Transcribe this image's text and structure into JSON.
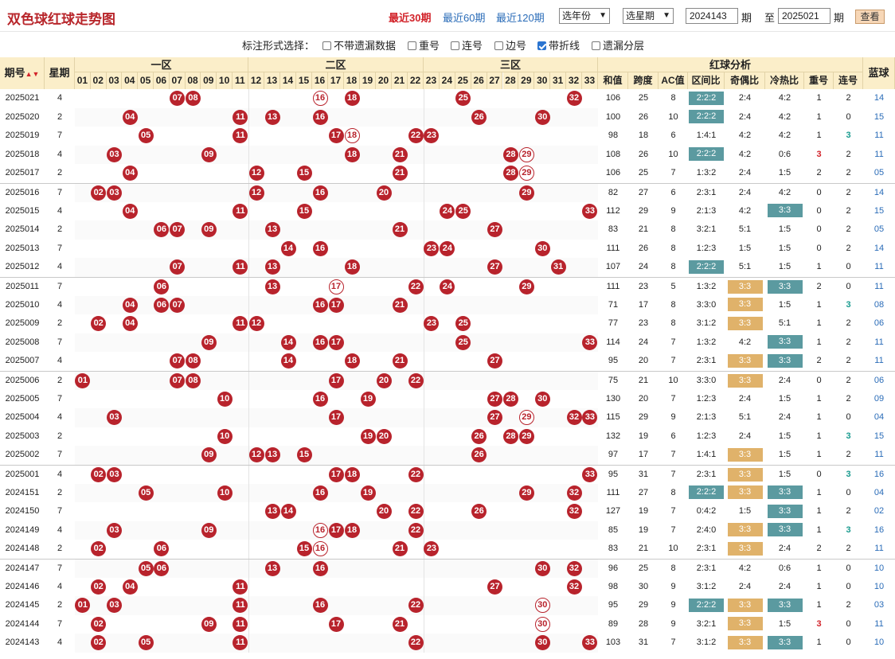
{
  "header": {
    "title": "双色球红球走势图",
    "periods": [
      {
        "label": "最近30期",
        "active": true
      },
      {
        "label": "最近60期",
        "active": false
      },
      {
        "label": "最近120期",
        "active": false
      }
    ],
    "year_select": "选年份",
    "week_select": "选星期",
    "from_issue": "2024143",
    "issue_unit": "期",
    "to_label": "至",
    "to_issue": "2025021",
    "query_button": "查看"
  },
  "options": {
    "label": "标注形式选择：",
    "items": [
      {
        "label": "不带遗漏数据",
        "checked": false
      },
      {
        "label": "重号",
        "checked": false
      },
      {
        "label": "连号",
        "checked": false
      },
      {
        "label": "边号",
        "checked": false
      },
      {
        "label": "带折线",
        "checked": true
      },
      {
        "label": "遗漏分层",
        "checked": false
      }
    ]
  },
  "table_header": {
    "issue": "期号",
    "weekday": "星期",
    "zone1": "一区",
    "zone2": "二区",
    "zone3": "三区",
    "analysis": "红球分析",
    "blue": "蓝球",
    "numbers": [
      "01",
      "02",
      "03",
      "04",
      "05",
      "06",
      "07",
      "08",
      "09",
      "10",
      "11",
      "12",
      "13",
      "14",
      "15",
      "16",
      "17",
      "18",
      "19",
      "20",
      "21",
      "22",
      "23",
      "24",
      "25",
      "26",
      "27",
      "28",
      "29",
      "30",
      "31",
      "32",
      "33"
    ],
    "analysis_cols": [
      "和值",
      "跨度",
      "AC值",
      "区间比",
      "奇偶比",
      "冷热比",
      "重号",
      "连号"
    ]
  },
  "rows": [
    {
      "issue": "2025021",
      "week": "4",
      "balls": [
        7,
        8,
        16,
        18,
        25,
        32
      ],
      "sum": "106",
      "span": "25",
      "ac": "8",
      "zone": "2:2:2",
      "odd": "2:4",
      "hot": "4:2",
      "rep": "1",
      "cons": "2",
      "blue": "14"
    },
    {
      "issue": "2025020",
      "week": "2",
      "balls": [
        4,
        11,
        13,
        16,
        26,
        30
      ],
      "sum": "100",
      "span": "26",
      "ac": "10",
      "zone": "2:2:2",
      "odd": "2:4",
      "hot": "4:2",
      "rep": "1",
      "cons": "0",
      "blue": "15"
    },
    {
      "issue": "2025019",
      "week": "7",
      "balls": [
        5,
        11,
        17,
        18,
        22,
        23
      ],
      "sum": "98",
      "span": "18",
      "ac": "6",
      "zone": "1:4:1",
      "odd": "4:2",
      "hot": "4:2",
      "rep": "1",
      "cons": "3",
      "blue": "11"
    },
    {
      "issue": "2025018",
      "week": "4",
      "balls": [
        3,
        9,
        18,
        21,
        28,
        29
      ],
      "sum": "108",
      "span": "26",
      "ac": "10",
      "zone": "2:2:2",
      "odd": "4:2",
      "hot": "0:6",
      "rep": "3",
      "cons": "2",
      "blue": "11"
    },
    {
      "issue": "2025017",
      "week": "2",
      "balls": [
        4,
        12,
        15,
        21,
        28,
        29
      ],
      "sum": "106",
      "span": "25",
      "ac": "7",
      "zone": "1:3:2",
      "odd": "2:4",
      "hot": "1:5",
      "rep": "2",
      "cons": "2",
      "blue": "05"
    },
    {
      "issue": "2025016",
      "week": "7",
      "balls": [
        2,
        3,
        12,
        16,
        20,
        29
      ],
      "sum": "82",
      "span": "27",
      "ac": "6",
      "zone": "2:3:1",
      "odd": "2:4",
      "hot": "4:2",
      "rep": "0",
      "cons": "2",
      "blue": "14"
    },
    {
      "issue": "2025015",
      "week": "4",
      "balls": [
        4,
        11,
        15,
        24,
        25,
        33
      ],
      "sum": "112",
      "span": "29",
      "ac": "9",
      "zone": "2:1:3",
      "odd": "4:2",
      "hot": "3:3",
      "rep": "0",
      "cons": "2",
      "blue": "15"
    },
    {
      "issue": "2025014",
      "week": "2",
      "balls": [
        6,
        7,
        9,
        13,
        21,
        27
      ],
      "sum": "83",
      "span": "21",
      "ac": "8",
      "zone": "3:2:1",
      "odd": "5:1",
      "hot": "1:5",
      "rep": "0",
      "cons": "2",
      "blue": "05"
    },
    {
      "issue": "2025013",
      "week": "7",
      "balls": [
        14,
        16,
        23,
        24,
        30
      ],
      "sum": "111",
      "span": "26",
      "ac": "8",
      "zone": "1:2:3",
      "odd": "1:5",
      "hot": "1:5",
      "rep": "0",
      "cons": "2",
      "blue": "14"
    },
    {
      "issue": "2025012",
      "week": "4",
      "balls": [
        7,
        11,
        13,
        18,
        27,
        31
      ],
      "sum": "107",
      "span": "24",
      "ac": "8",
      "zone": "2:2:2",
      "odd": "5:1",
      "hot": "1:5",
      "rep": "1",
      "cons": "0",
      "blue": "11"
    },
    {
      "issue": "2025011",
      "week": "7",
      "balls": [
        6,
        13,
        17,
        22,
        24,
        29
      ],
      "sum": "111",
      "span": "23",
      "ac": "5",
      "zone": "1:3:2",
      "odd": "3:3",
      "hot": "3:3",
      "rep": "2",
      "cons": "0",
      "blue": "11"
    },
    {
      "issue": "2025010",
      "week": "4",
      "balls": [
        4,
        6,
        7,
        16,
        17,
        21
      ],
      "sum": "71",
      "span": "17",
      "ac": "8",
      "zone": "3:3:0",
      "odd": "3:3",
      "hot": "1:5",
      "rep": "1",
      "cons": "3",
      "blue": "08"
    },
    {
      "issue": "2025009",
      "week": "2",
      "balls": [
        2,
        4,
        11,
        12,
        23,
        25
      ],
      "sum": "77",
      "span": "23",
      "ac": "8",
      "zone": "3:1:2",
      "odd": "3:3",
      "hot": "5:1",
      "rep": "1",
      "cons": "2",
      "blue": "06"
    },
    {
      "issue": "2025008",
      "week": "7",
      "balls": [
        9,
        14,
        16,
        17,
        25,
        33
      ],
      "sum": "114",
      "span": "24",
      "ac": "7",
      "zone": "1:3:2",
      "odd": "4:2",
      "hot": "3:3",
      "rep": "1",
      "cons": "2",
      "blue": "11"
    },
    {
      "issue": "2025007",
      "week": "4",
      "balls": [
        7,
        8,
        14,
        18,
        21,
        27
      ],
      "sum": "95",
      "span": "20",
      "ac": "7",
      "zone": "2:3:1",
      "odd": "3:3",
      "hot": "3:3",
      "rep": "2",
      "cons": "2",
      "blue": "11"
    },
    {
      "issue": "2025006",
      "week": "2",
      "balls": [
        1,
        7,
        8,
        17,
        20,
        22
      ],
      "sum": "75",
      "span": "21",
      "ac": "10",
      "zone": "3:3:0",
      "odd": "3:3",
      "hot": "2:4",
      "rep": "0",
      "cons": "2",
      "blue": "06"
    },
    {
      "issue": "2025005",
      "week": "7",
      "balls": [
        10,
        16,
        19,
        27,
        28,
        30
      ],
      "sum": "130",
      "span": "20",
      "ac": "7",
      "zone": "1:2:3",
      "odd": "2:4",
      "hot": "1:5",
      "rep": "1",
      "cons": "2",
      "blue": "09"
    },
    {
      "issue": "2025004",
      "week": "4",
      "balls": [
        3,
        17,
        27,
        29,
        32,
        33
      ],
      "sum": "115",
      "span": "29",
      "ac": "9",
      "zone": "2:1:3",
      "odd": "5:1",
      "hot": "2:4",
      "rep": "1",
      "cons": "0",
      "blue": "04"
    },
    {
      "issue": "2025003",
      "week": "2",
      "balls": [
        10,
        19,
        20,
        26,
        28,
        29
      ],
      "sum": "132",
      "span": "19",
      "ac": "6",
      "zone": "1:2:3",
      "odd": "2:4",
      "hot": "1:5",
      "rep": "1",
      "cons": "3",
      "blue": "15"
    },
    {
      "issue": "2025002",
      "week": "7",
      "balls": [
        9,
        12,
        13,
        15,
        26
      ],
      "sum": "97",
      "span": "17",
      "ac": "7",
      "zone": "1:4:1",
      "odd": "3:3",
      "hot": "1:5",
      "rep": "1",
      "cons": "2",
      "blue": "11"
    },
    {
      "issue": "2025001",
      "week": "4",
      "balls": [
        2,
        3,
        17,
        18,
        22,
        33
      ],
      "sum": "95",
      "span": "31",
      "ac": "7",
      "zone": "2:3:1",
      "odd": "3:3",
      "hot": "1:5",
      "rep": "0",
      "cons": "3",
      "blue": "16"
    },
    {
      "issue": "2024151",
      "week": "2",
      "balls": [
        5,
        10,
        16,
        19,
        29,
        32
      ],
      "sum": "111",
      "span": "27",
      "ac": "8",
      "zone": "2:2:2",
      "odd": "3:3",
      "hot": "3:3",
      "rep": "1",
      "cons": "0",
      "blue": "04"
    },
    {
      "issue": "2024150",
      "week": "7",
      "balls": [
        13,
        14,
        20,
        22,
        26,
        32
      ],
      "sum": "127",
      "span": "19",
      "ac": "7",
      "zone": "0:4:2",
      "odd": "1:5",
      "hot": "3:3",
      "rep": "1",
      "cons": "2",
      "blue": "02"
    },
    {
      "issue": "2024149",
      "week": "4",
      "balls": [
        3,
        9,
        16,
        17,
        18,
        22
      ],
      "sum": "85",
      "span": "19",
      "ac": "7",
      "zone": "2:4:0",
      "odd": "3:3",
      "hot": "3:3",
      "rep": "1",
      "cons": "3",
      "blue": "16"
    },
    {
      "issue": "2024148",
      "week": "2",
      "balls": [
        2,
        6,
        15,
        16,
        21,
        23
      ],
      "sum": "83",
      "span": "21",
      "ac": "10",
      "zone": "2:3:1",
      "odd": "3:3",
      "hot": "2:4",
      "rep": "2",
      "cons": "2",
      "blue": "11"
    },
    {
      "issue": "2024147",
      "week": "7",
      "balls": [
        5,
        6,
        13,
        16,
        30,
        32
      ],
      "sum": "96",
      "span": "25",
      "ac": "8",
      "zone": "2:3:1",
      "odd": "4:2",
      "hot": "0:6",
      "rep": "1",
      "cons": "0",
      "blue": "10"
    },
    {
      "issue": "2024146",
      "week": "4",
      "balls": [
        2,
        4,
        11,
        27,
        32
      ],
      "sum": "98",
      "span": "30",
      "ac": "9",
      "zone": "3:1:2",
      "odd": "2:4",
      "hot": "2:4",
      "rep": "1",
      "cons": "0",
      "blue": "10"
    },
    {
      "issue": "2024145",
      "week": "2",
      "balls": [
        1,
        3,
        11,
        16,
        22,
        30
      ],
      "sum": "95",
      "span": "29",
      "ac": "9",
      "zone": "2:2:2",
      "odd": "3:3",
      "hot": "3:3",
      "rep": "1",
      "cons": "2",
      "blue": "03"
    },
    {
      "issue": "2024144",
      "week": "7",
      "balls": [
        2,
        9,
        11,
        17,
        21,
        30
      ],
      "sum": "89",
      "span": "28",
      "ac": "9",
      "zone": "3:2:1",
      "odd": "3:3",
      "hot": "1:5",
      "rep": "3",
      "cons": "0",
      "blue": "11"
    },
    {
      "issue": "2024143",
      "week": "4",
      "balls": [
        2,
        5,
        11,
        22,
        30,
        33
      ],
      "sum": "103",
      "span": "31",
      "ac": "7",
      "zone": "3:1:2",
      "odd": "3:3",
      "hot": "3:3",
      "rep": "1",
      "cons": "0",
      "blue": "10"
    }
  ]
}
